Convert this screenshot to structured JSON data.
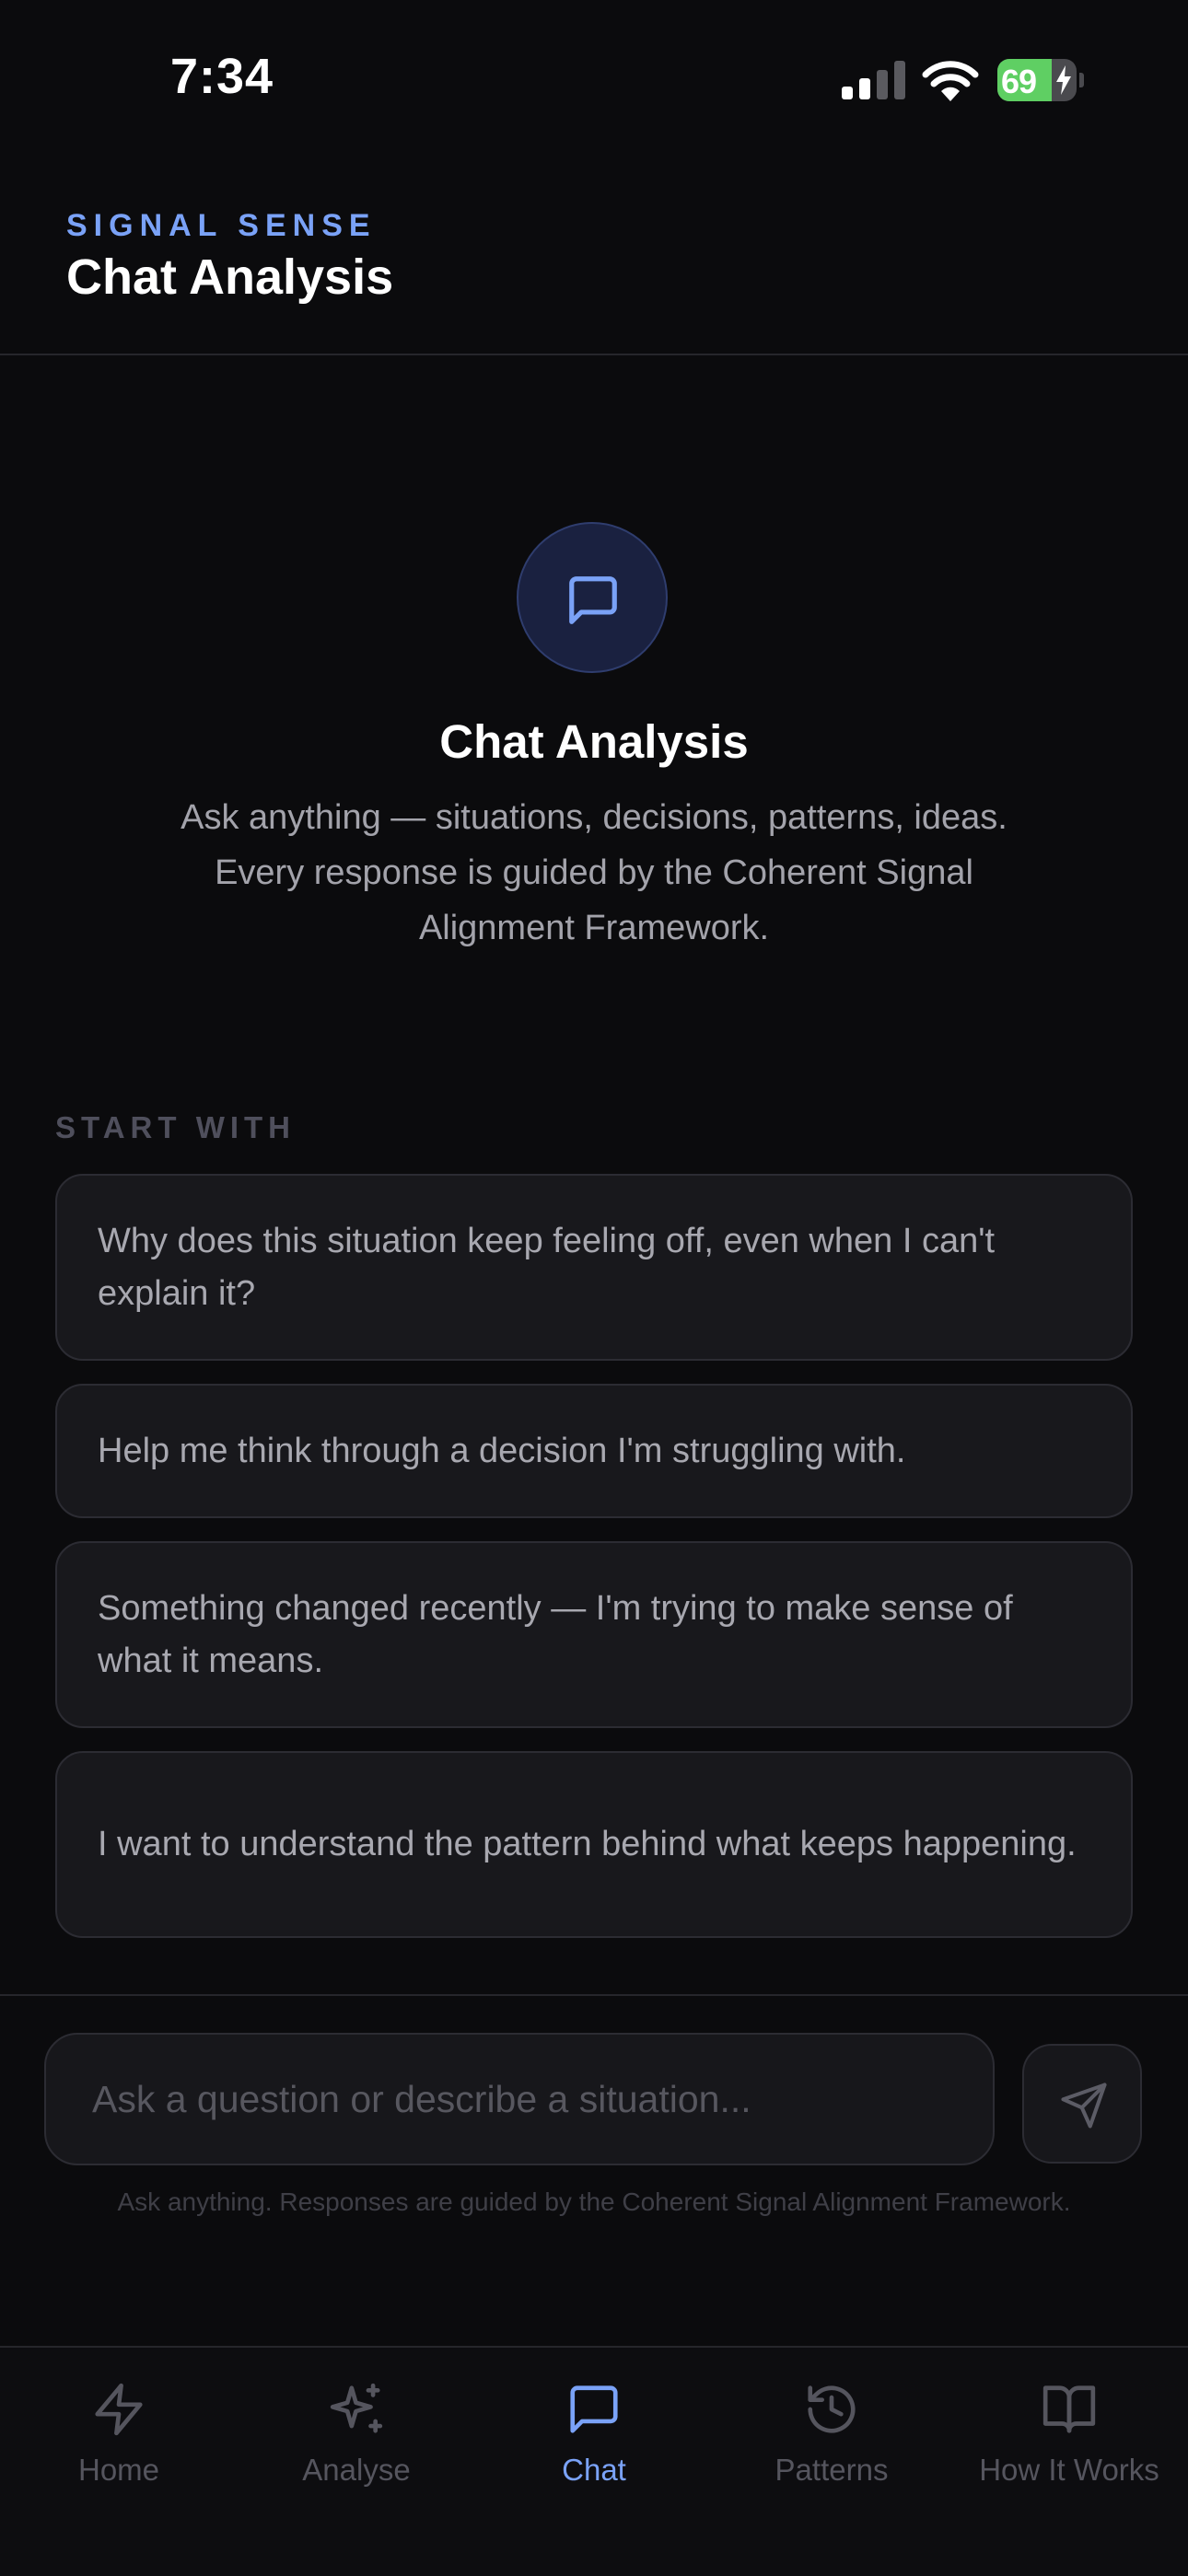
{
  "status_bar": {
    "time": "7:34",
    "battery_level": "69",
    "battery_fraction": 0.69,
    "icons": [
      "signal-icon",
      "wifi-icon",
      "battery-icon",
      "charging-bolt-icon"
    ]
  },
  "header": {
    "brand": "SIGNAL SENSE",
    "title": "Chat Analysis"
  },
  "hero": {
    "icon": "chat-bubble-icon",
    "title": "Chat Analysis",
    "description": "Ask anything — situations, decisions, patterns, ideas. Every response is guided by the Coherent Signal Alignment Framework."
  },
  "start_with": {
    "label": "START WITH",
    "prompts": [
      "Why does this situation keep feeling off, even when I can't explain it?",
      "Help me think through a decision I'm struggling with.",
      "Something changed recently — I'm trying to make sense of what it means.",
      "I want to understand the pattern behind what keeps happening."
    ]
  },
  "composer": {
    "placeholder": "Ask a question or describe a situation...",
    "value": "",
    "send_icon": "send-icon",
    "disclaimer": "Ask anything. Responses are guided by the Coherent Signal Alignment Framework."
  },
  "tabs": [
    {
      "label": "Home",
      "icon": "lightning-icon",
      "active": false
    },
    {
      "label": "Analyse",
      "icon": "sparkles-icon",
      "active": false
    },
    {
      "label": "Chat",
      "icon": "chat-bubble-icon",
      "active": true
    },
    {
      "label": "Patterns",
      "icon": "history-icon",
      "active": false
    },
    {
      "label": "How It Works",
      "icon": "book-icon",
      "active": false
    }
  ],
  "colors": {
    "background": "#0b0b0d",
    "accent": "#7aa2f7",
    "card": "#18181c",
    "muted_text": "#a3a3ab",
    "battery_green": "#5fcf63"
  }
}
